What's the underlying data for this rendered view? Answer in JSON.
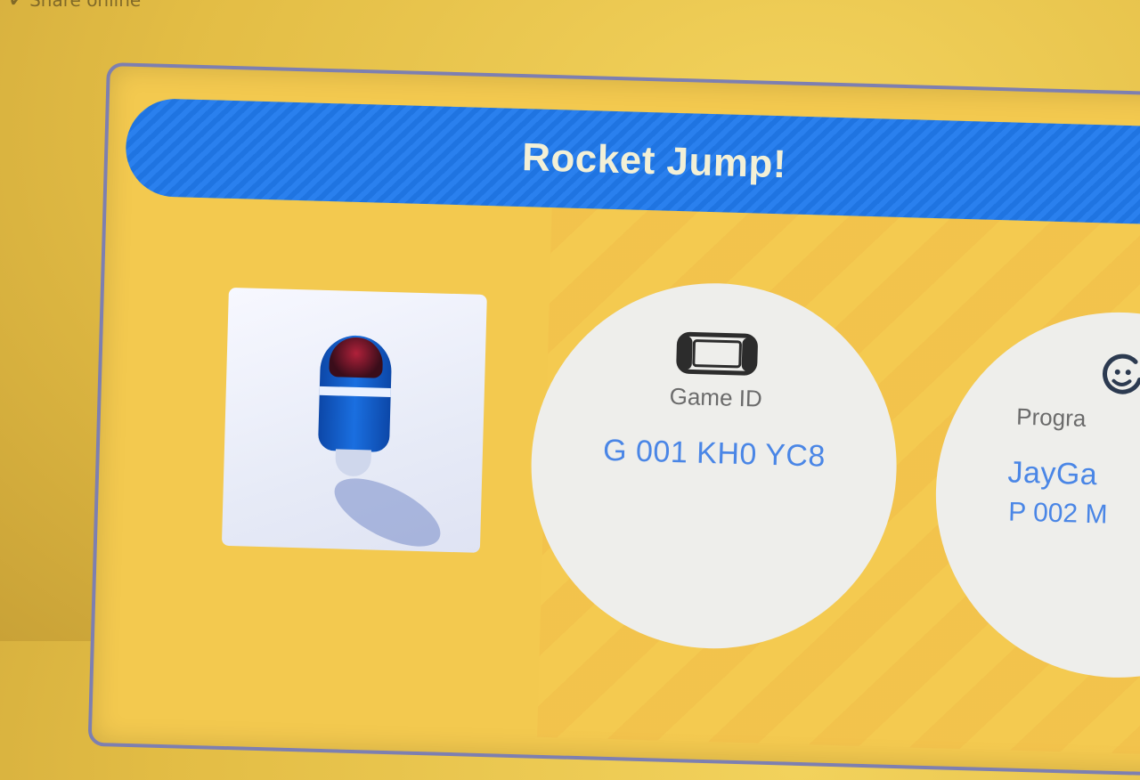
{
  "top_hint": "✔ Share online",
  "title": "Rocket Jump!",
  "game": {
    "label": "Game ID",
    "value": "G 001 KH0 YC8",
    "icon": "console-icon"
  },
  "programmer": {
    "label": "Progra",
    "name": "JayGa",
    "id": "P 002 M",
    "icon": "smiley-icon"
  },
  "colors": {
    "title_bar": "#1f74e1",
    "background": "#f3c94f",
    "id_text": "#4a86e6"
  }
}
